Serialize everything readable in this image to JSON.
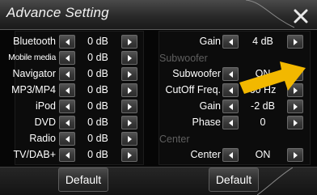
{
  "header": {
    "title": "Advance Setting",
    "close_icon": "close-icon"
  },
  "left_panel": {
    "rows": [
      {
        "label": "Bluetooth",
        "value": "0 dB",
        "narrow": false
      },
      {
        "label": "Mobile media",
        "value": "0 dB",
        "narrow": true
      },
      {
        "label": "Navigator",
        "value": "0 dB",
        "narrow": false
      },
      {
        "label": "MP3/MP4",
        "value": "0 dB",
        "narrow": false
      },
      {
        "label": "iPod",
        "value": "0 dB",
        "narrow": false
      },
      {
        "label": "DVD",
        "value": "0 dB",
        "narrow": false
      },
      {
        "label": "Radio",
        "value": "0 dB",
        "narrow": false
      },
      {
        "label": "TV/DAB+",
        "value": "0 dB",
        "narrow": false
      }
    ]
  },
  "right_panel": {
    "gain": {
      "label": "Gain",
      "value": "4 dB"
    },
    "subwoofer_section": "Subwoofer",
    "subwoofer": {
      "label": "Subwoofer",
      "value": "ON"
    },
    "cutoff": {
      "label": "CutOff Freq.",
      "value": "60 Hz"
    },
    "sub_gain": {
      "label": "Gain",
      "value": "-2 dB"
    },
    "phase": {
      "label": "Phase",
      "value": "0"
    },
    "center_section": "Center",
    "center": {
      "label": "Center",
      "value": "ON"
    }
  },
  "footer": {
    "left_default_label": "Default",
    "right_default_label": "Default"
  },
  "colors": {
    "accent_arrow": "#f2b800",
    "section_text": "#5f5f5f"
  }
}
